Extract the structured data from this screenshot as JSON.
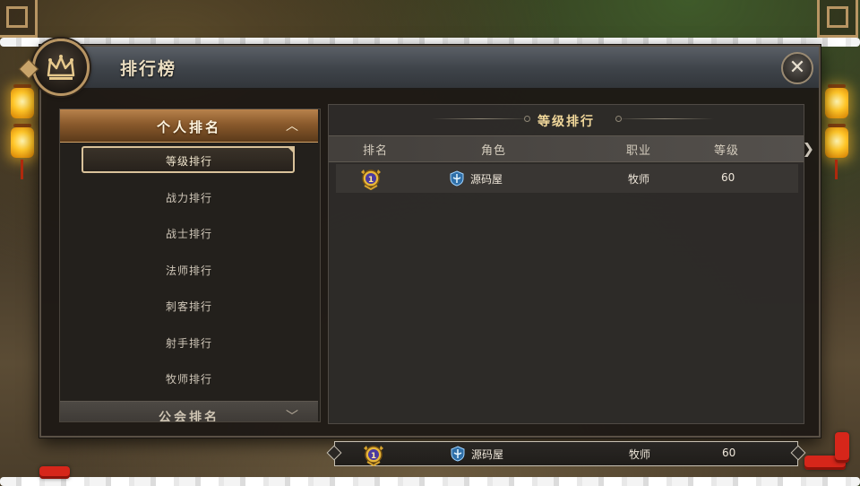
{
  "window": {
    "title": "排行榜",
    "close_icon": "close-icon"
  },
  "left_nav": {
    "category_personal": "个人排名",
    "category_guild": "公会排名",
    "items": [
      {
        "label": "等级排行",
        "selected": true
      },
      {
        "label": "战力排行",
        "selected": false
      },
      {
        "label": "战士排行",
        "selected": false
      },
      {
        "label": "法师排行",
        "selected": false
      },
      {
        "label": "刺客排行",
        "selected": false
      },
      {
        "label": "射手排行",
        "selected": false
      },
      {
        "label": "牧师排行",
        "selected": false
      }
    ]
  },
  "ranking": {
    "title": "等级排行",
    "columns": {
      "rank": "排名",
      "role": "角色",
      "job": "职业",
      "level": "等级"
    },
    "rows": [
      {
        "rank": 1,
        "rank_icon": "gold-medal-icon",
        "role": "源码屋",
        "role_icon": "priest-class-icon",
        "job": "牧师",
        "level": "60"
      }
    ],
    "my_rank": {
      "rank": 1,
      "rank_icon": "gold-medal-icon",
      "role": "源码屋",
      "role_icon": "priest-class-icon",
      "job": "牧师",
      "level": "60"
    }
  },
  "colors": {
    "accent_gold": "#f0d79a",
    "header_orange": "#8a5a2c",
    "panel_dark": "#232019"
  }
}
